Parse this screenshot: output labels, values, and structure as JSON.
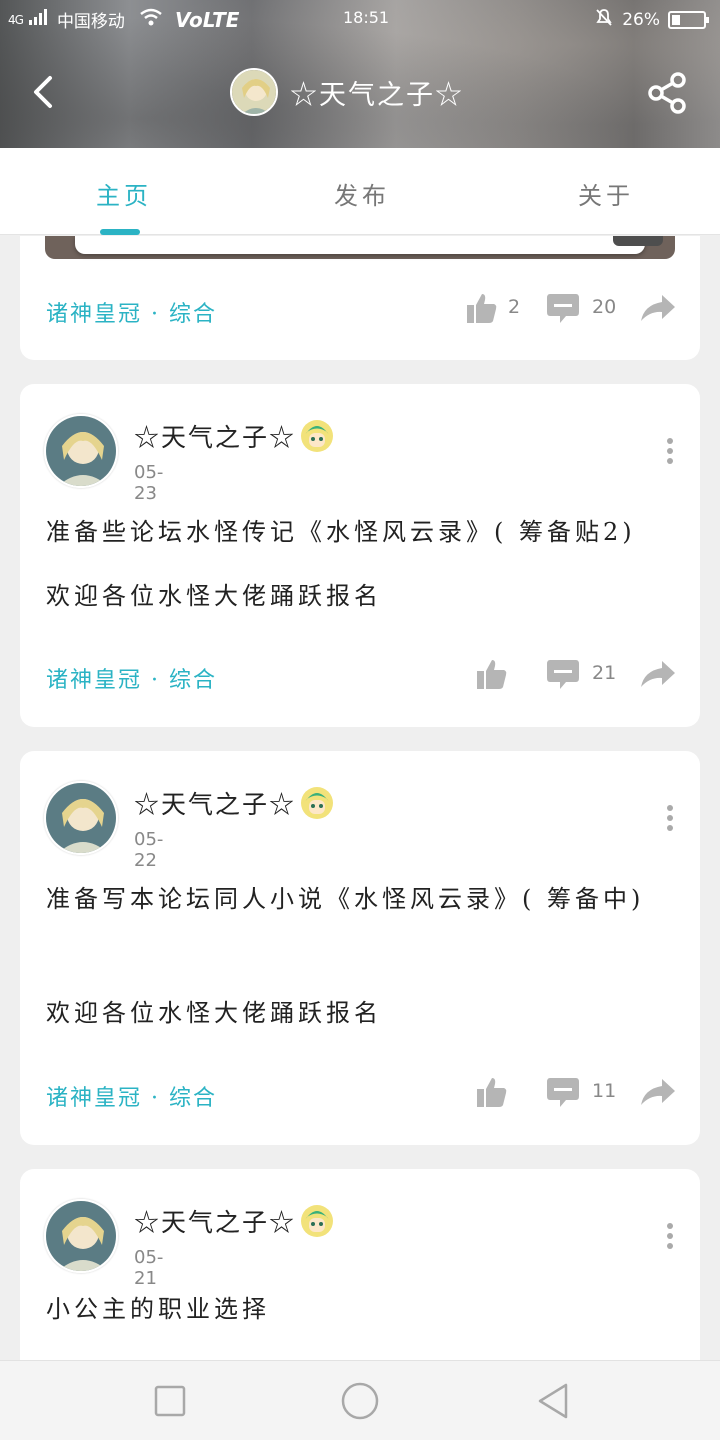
{
  "status_bar": {
    "network": "4G",
    "carrier": "中国移动",
    "volte": "VoLTE",
    "time": "18:51",
    "battery": "26%",
    "battery_level": 0.26
  },
  "header": {
    "title": "☆天气之子☆"
  },
  "tabs": [
    {
      "label": "主页",
      "active": true
    },
    {
      "label": "发布",
      "active": false
    },
    {
      "label": "关于",
      "active": false
    }
  ],
  "posts": [
    {
      "category": "诸神皇冠 · 综合",
      "likes": "2",
      "comments": "20"
    },
    {
      "author": "☆天气之子☆",
      "date": "05-23",
      "paragraphs": [
        "准备些论坛水怪传记《水怪风云录》( 筹备贴2)",
        "欢迎各位水怪大佬踊跃报名"
      ],
      "category": "诸神皇冠 · 综合",
      "likes": "",
      "comments": "21"
    },
    {
      "author": "☆天气之子☆",
      "date": "05-22",
      "paragraphs": [
        "准备写本论坛同人小说《水怪风云录》( 筹备中)",
        "欢迎各位水怪大佬踊跃报名"
      ],
      "category": "诸神皇冠 · 综合",
      "likes": "",
      "comments": "11"
    },
    {
      "author": "☆天气之子☆",
      "date": "05-21",
      "paragraphs": [
        "小公主的职业选择"
      ]
    }
  ],
  "colors": {
    "accent": "#2bb3c4",
    "muted": "#888888",
    "card": "#ffffff",
    "background": "#efefef"
  }
}
